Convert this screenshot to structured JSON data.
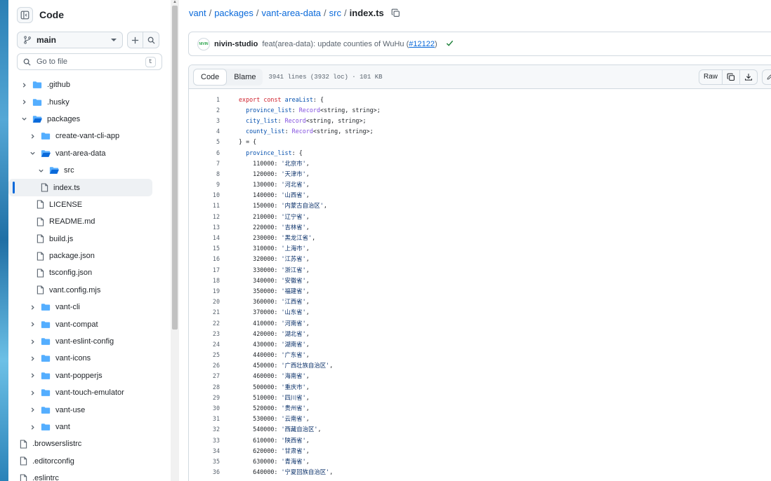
{
  "sidebar": {
    "title": "Code",
    "branch": "main",
    "goto_placeholder": "Go to file",
    "goto_shortcut": "t",
    "tree": [
      {
        "label": ".github",
        "type": "folder",
        "depth": 0,
        "expanded": false
      },
      {
        "label": ".husky",
        "type": "folder",
        "depth": 0,
        "expanded": false
      },
      {
        "label": "packages",
        "type": "folder",
        "depth": 0,
        "expanded": true
      },
      {
        "label": "create-vant-cli-app",
        "type": "folder",
        "depth": 1,
        "expanded": false
      },
      {
        "label": "vant-area-data",
        "type": "folder",
        "depth": 1,
        "expanded": true
      },
      {
        "label": "src",
        "type": "folder",
        "depth": 2,
        "expanded": true
      },
      {
        "label": "index.ts",
        "type": "file",
        "depth": 3,
        "selected": true
      },
      {
        "label": "LICENSE",
        "type": "file",
        "depth": 2
      },
      {
        "label": "README.md",
        "type": "file",
        "depth": 2
      },
      {
        "label": "build.js",
        "type": "file",
        "depth": 2
      },
      {
        "label": "package.json",
        "type": "file",
        "depth": 2
      },
      {
        "label": "tsconfig.json",
        "type": "file",
        "depth": 2
      },
      {
        "label": "vant.config.mjs",
        "type": "file",
        "depth": 2
      },
      {
        "label": "vant-cli",
        "type": "folder",
        "depth": 1,
        "expanded": false
      },
      {
        "label": "vant-compat",
        "type": "folder",
        "depth": 1,
        "expanded": false
      },
      {
        "label": "vant-eslint-config",
        "type": "folder",
        "depth": 1,
        "expanded": false
      },
      {
        "label": "vant-icons",
        "type": "folder",
        "depth": 1,
        "expanded": false
      },
      {
        "label": "vant-popperjs",
        "type": "folder",
        "depth": 1,
        "expanded": false
      },
      {
        "label": "vant-touch-emulator",
        "type": "folder",
        "depth": 1,
        "expanded": false
      },
      {
        "label": "vant-use",
        "type": "folder",
        "depth": 1,
        "expanded": false
      },
      {
        "label": "vant",
        "type": "folder",
        "depth": 1,
        "expanded": false
      },
      {
        "label": ".browserslistrc",
        "type": "file",
        "depth": 0
      },
      {
        "label": ".editorconfig",
        "type": "file",
        "depth": 0
      },
      {
        "label": ".eslintrc",
        "type": "file",
        "depth": 0
      }
    ]
  },
  "breadcrumb": {
    "repo": "vant",
    "parts": [
      "packages",
      "vant-area-data",
      "src"
    ],
    "file": "index.ts"
  },
  "commit": {
    "avatar_text": "NIVIN",
    "author": "nivin-studio",
    "message_prefix": "feat(area-data): update counties of WuHu (",
    "pr_link": "#12122",
    "message_suffix": ")"
  },
  "file": {
    "tab_code": "Code",
    "tab_blame": "Blame",
    "meta": "3941 lines (3932 loc) · 101 KB",
    "raw_label": "Raw"
  },
  "code_lines": [
    {
      "n": "1",
      "t": "export const areaList: {"
    },
    {
      "n": "2",
      "t": "  province_list: Record<string, string>;"
    },
    {
      "n": "3",
      "t": "  city_list: Record<string, string>;"
    },
    {
      "n": "4",
      "t": "  county_list: Record<string, string>;"
    },
    {
      "n": "5",
      "t": "} = {"
    },
    {
      "n": "6",
      "t": "  province_list: {"
    },
    {
      "n": "7",
      "t": "    110000: '北京市',"
    },
    {
      "n": "8",
      "t": "    120000: '天津市',"
    },
    {
      "n": "9",
      "t": "    130000: '河北省',"
    },
    {
      "n": "10",
      "t": "    140000: '山西省',"
    },
    {
      "n": "11",
      "t": "    150000: '内蒙古自治区',"
    },
    {
      "n": "12",
      "t": "    210000: '辽宁省',"
    },
    {
      "n": "13",
      "t": "    220000: '吉林省',"
    },
    {
      "n": "14",
      "t": "    230000: '黑龙江省',"
    },
    {
      "n": "15",
      "t": "    310000: '上海市',"
    },
    {
      "n": "16",
      "t": "    320000: '江苏省',"
    },
    {
      "n": "17",
      "t": "    330000: '浙江省',"
    },
    {
      "n": "18",
      "t": "    340000: '安徽省',"
    },
    {
      "n": "19",
      "t": "    350000: '福建省',"
    },
    {
      "n": "20",
      "t": "    360000: '江西省',"
    },
    {
      "n": "21",
      "t": "    370000: '山东省',"
    },
    {
      "n": "22",
      "t": "    410000: '河南省',"
    },
    {
      "n": "23",
      "t": "    420000: '湖北省',"
    },
    {
      "n": "24",
      "t": "    430000: '湖南省',"
    },
    {
      "n": "25",
      "t": "    440000: '广东省',"
    },
    {
      "n": "26",
      "t": "    450000: '广西壮族自治区',"
    },
    {
      "n": "27",
      "t": "    460000: '海南省',"
    },
    {
      "n": "28",
      "t": "    500000: '重庆市',"
    },
    {
      "n": "29",
      "t": "    510000: '四川省',"
    },
    {
      "n": "30",
      "t": "    520000: '贵州省',"
    },
    {
      "n": "31",
      "t": "    530000: '云南省',"
    },
    {
      "n": "32",
      "t": "    540000: '西藏自治区',"
    },
    {
      "n": "33",
      "t": "    610000: '陕西省',"
    },
    {
      "n": "34",
      "t": "    620000: '甘肃省',"
    },
    {
      "n": "35",
      "t": "    630000: '青海省',"
    },
    {
      "n": "36",
      "t": "    640000: '宁夏回族自治区',"
    }
  ]
}
